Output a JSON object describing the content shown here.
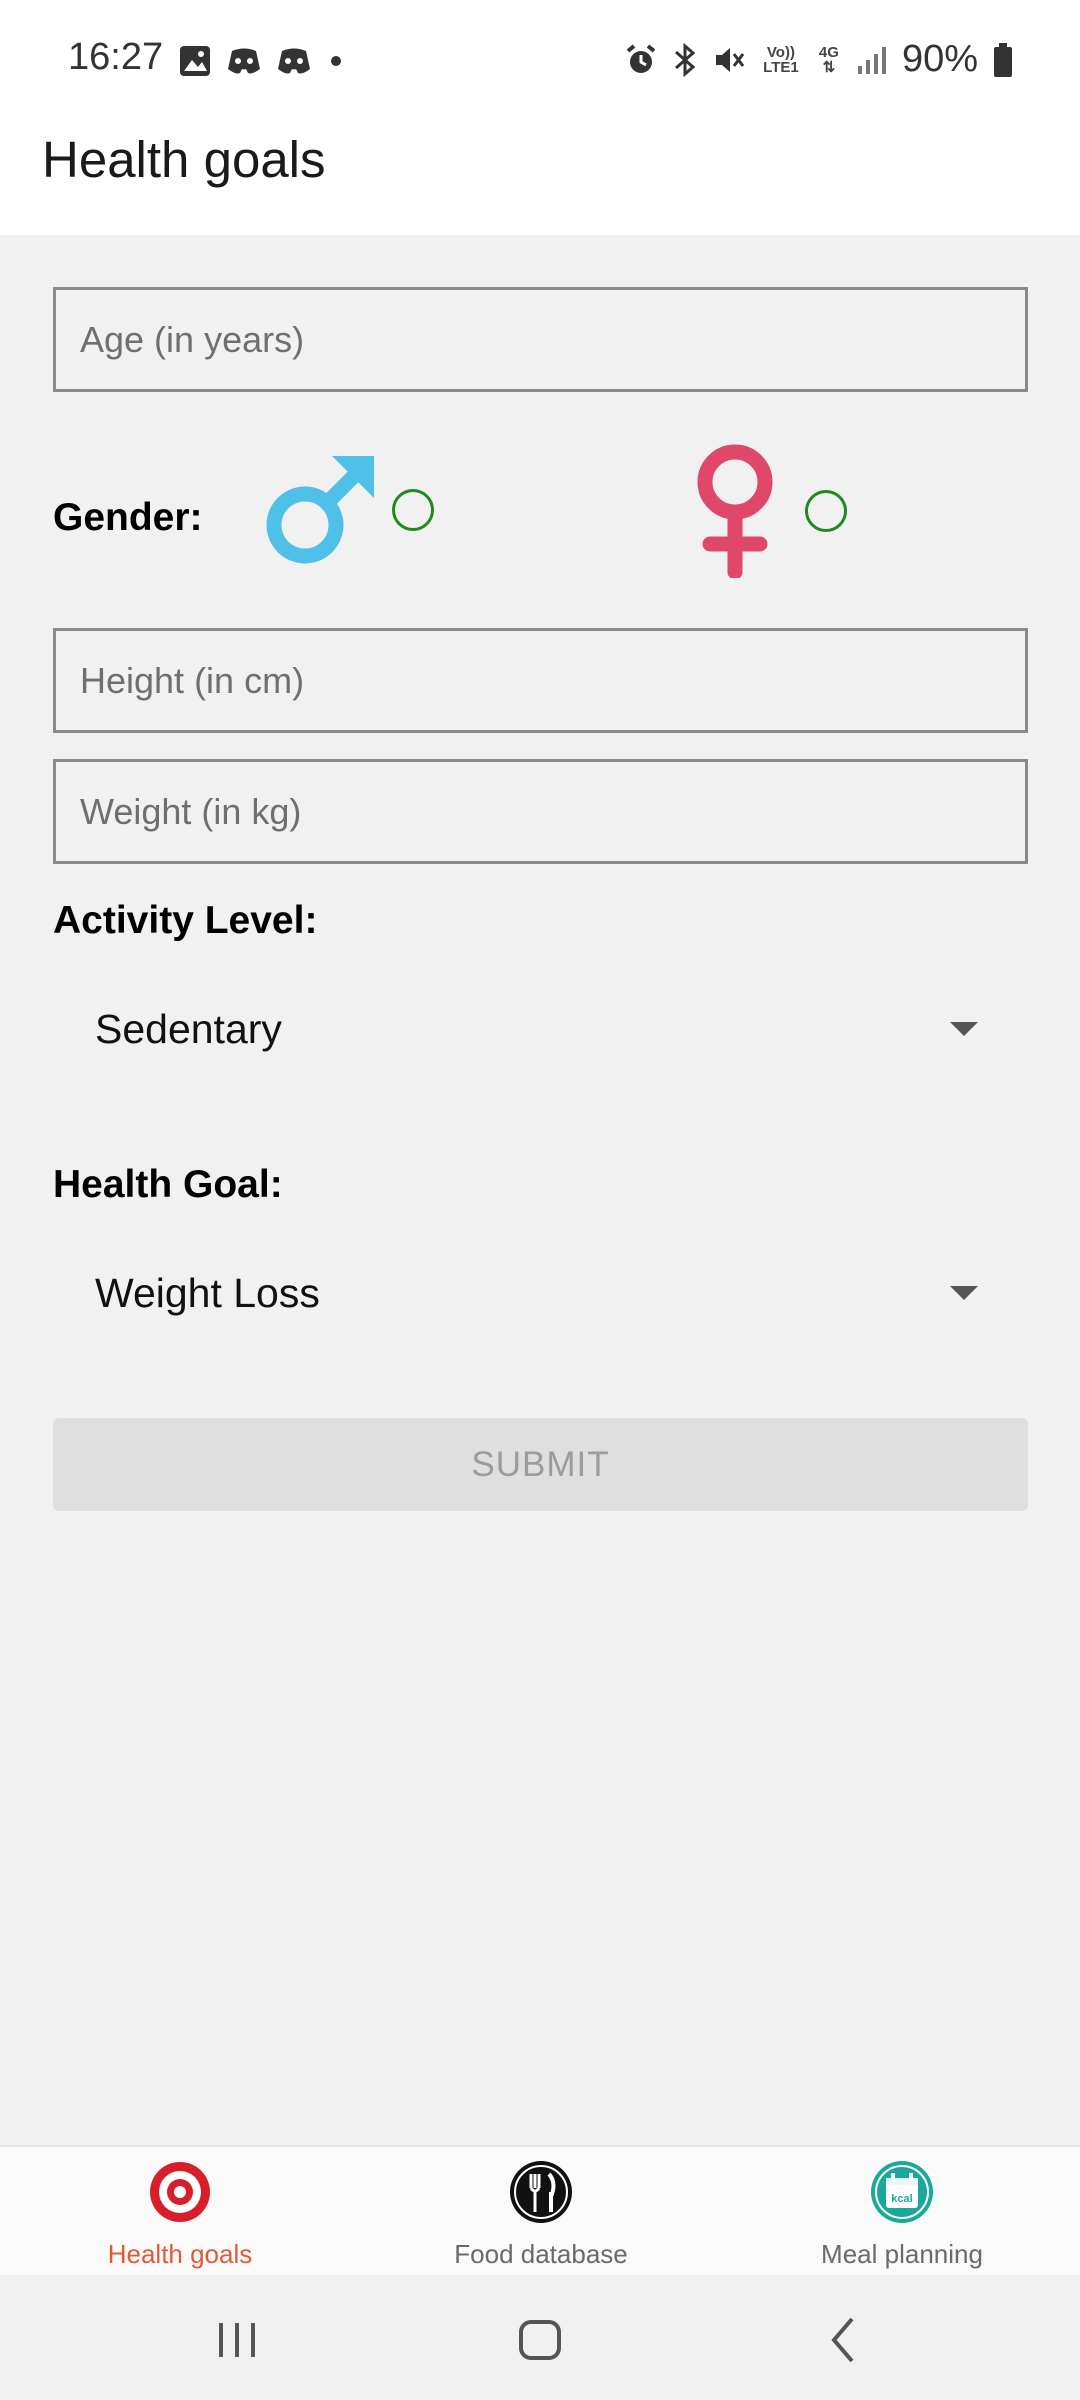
{
  "status_bar": {
    "time": "16:27",
    "battery_text": "90%",
    "net_volte": "Vo)) LTE1",
    "net_4g": "4G",
    "icons": [
      "gallery-icon",
      "discord-icon",
      "discord-icon",
      "dot-icon",
      "alarm-icon",
      "bluetooth-icon",
      "mute-icon",
      "volte-icon",
      "4g-icon",
      "signal-icon",
      "battery-icon"
    ]
  },
  "app_bar": {
    "title": "Health goals"
  },
  "form": {
    "age_placeholder": "Age (in years)",
    "gender_label": "Gender:",
    "male_color": "#4fc1e9",
    "female_color": "#e0486a",
    "radio_color": "#1f8a1f",
    "height_placeholder": "Height (in cm)",
    "weight_placeholder": "Weight (in kg)",
    "activity_label": "Activity Level:",
    "activity_value": "Sedentary",
    "goal_label": "Health Goal:",
    "goal_value": "Weight Loss",
    "submit_label": "SUBMIT"
  },
  "bottom_nav": {
    "items": [
      {
        "label": "Health goals",
        "icon": "target-icon",
        "active": true
      },
      {
        "label": "Food database",
        "icon": "fork-knife-icon",
        "active": false
      },
      {
        "label": "Meal planning",
        "icon": "kcal-calendar-icon",
        "active": false
      }
    ],
    "kcal_text": "kcal",
    "active_color": "#e05a3a"
  },
  "system_nav": {
    "buttons": [
      "recents-icon",
      "home-icon",
      "back-icon"
    ]
  }
}
